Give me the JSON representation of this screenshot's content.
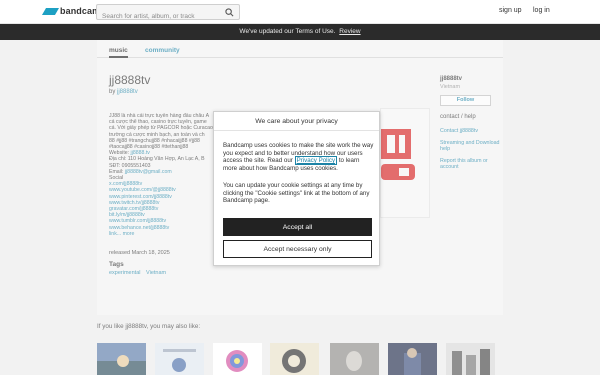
{
  "header": {
    "logo_text": "bandcamp",
    "search_placeholder": "Search for artist, album, or track",
    "signup": "sign up",
    "login": "log in"
  },
  "banner": {
    "text": "We've updated our Terms of Use.",
    "link": "Review"
  },
  "tabs": {
    "music": "music",
    "community": "community"
  },
  "album": {
    "title": "jj8888tv",
    "by_prefix": "by",
    "artist": "jj8888tv",
    "desc_lines": [
      "JJ88 là nhà cái trực tuyến hàng đầu châu Á",
      "cá cược thể thao, casino trực tuyến, game",
      "cá. Với giấy phép từ PAGCOR hoặc Curacao",
      "trường cá cược minh bạch, an toàn và ch",
      "88 #jj88 #trangchujj88 #nhacaijj88 #jj88",
      "#taocajj88 #casinojj88 #ttethanjj88"
    ],
    "website_label": "Website:",
    "website": "jj8888.tv",
    "address": "Địa chỉ: 110 Hoàng Văn Hợp, An Lạc A, B",
    "phone": "SĐT: 0905551403",
    "email_label": "Email:",
    "email": "jj8888tv@gmail.com",
    "social_label": "Social",
    "social_links": [
      "x.com/jj8888tv",
      "www.youtube.com/@jj8888tv",
      "www.pinterest.com/jj8888tv",
      "www.twitch.tv/jj8888tv",
      "gravatar.com/jj8888tv",
      "bit.ly/m/jj8888tv",
      "www.tumblr.com/jj8888tv",
      "www.behance.net/jj8888tv"
    ],
    "truncated_link": "link...",
    "more": "more",
    "released": "released March 18, 2025",
    "tags_heading": "Tags",
    "tags": [
      "experimental",
      "Vietnam"
    ]
  },
  "sidebar": {
    "name": "jj8888tv",
    "location": "Vietnam",
    "follow": "Follow",
    "contact_heading": "contact / help",
    "links": [
      "Contact jj8888tv",
      "Streaming and Download help",
      "Report this album or account"
    ]
  },
  "recommendations": {
    "heading": "If you like jj8888tv, you may also like:"
  },
  "modal": {
    "title": "We care about your privacy",
    "para1_a": "Bandcamp uses cookies to make the site work the way you expect and to better understand how our users access the site. Read our",
    "privacy_link": "Privacy Policy",
    "para1_b": "to learn more about how Bandcamp uses cookies.",
    "para2": "You can update your cookie settings at any time by clicking the \"Cookie settings\" link at the bottom of any Bandcamp page.",
    "accept_all": "Accept all",
    "accept_necessary": "Accept necessary only"
  },
  "colors": {
    "brand": "#1da0c3",
    "link": "#1c83a6",
    "banner": "#2b2b2b",
    "button_dark": "#222222"
  }
}
